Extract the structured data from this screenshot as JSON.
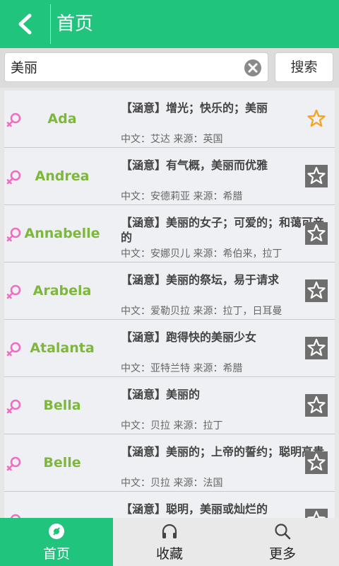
{
  "header": {
    "title": "首页"
  },
  "search": {
    "query": "美丽",
    "button_label": "搜索"
  },
  "list": [
    {
      "name": "Ada",
      "meaning": "【涵意】增光；快乐的；美丽",
      "meta": "中文：艾达   来源：英国",
      "favorited": true
    },
    {
      "name": "Andrea",
      "meaning": "【涵意】有气概，美丽而优雅",
      "meta": "中文：安德莉亚   来源：希腊",
      "favorited": false
    },
    {
      "name": "Annabelle",
      "meaning": "【涵意】美丽的女子；可爱的；和蔼可亲的",
      "meta": "中文：安娜贝儿   来源：希伯来，拉丁",
      "favorited": false
    },
    {
      "name": "Arabela",
      "meaning": "【涵意】美丽的祭坛，易于请求",
      "meta": "中文：爱勒贝拉   来源：拉丁，日耳曼",
      "favorited": false
    },
    {
      "name": "Atalanta",
      "meaning": "【涵意】跑得快的美丽少女",
      "meta": "中文：亚特兰特   来源：希腊",
      "favorited": false
    },
    {
      "name": "Bella",
      "meaning": "【涵意】美丽的",
      "meta": "中文：贝拉   来源：拉丁",
      "favorited": false
    },
    {
      "name": "Belle",
      "meaning": "【涵意】美丽的；上帝的誓约；聪明高贵",
      "meta": "中文：贝拉   来源：法国",
      "favorited": false
    },
    {
      "name": "",
      "meaning": "【涵意】聪明，美丽或灿烂的",
      "meta": "",
      "favorited": false
    }
  ],
  "nav": [
    {
      "label": "首页",
      "icon": "home-disc-icon",
      "active": true
    },
    {
      "label": "收藏",
      "icon": "headphones-icon",
      "active": false
    },
    {
      "label": "更多",
      "icon": "search-icon",
      "active": false
    }
  ],
  "colors": {
    "primary": "#20c47c",
    "name_green": "#7db83a",
    "female_pink": "#f06ec2",
    "star_orange": "#f5a623"
  }
}
